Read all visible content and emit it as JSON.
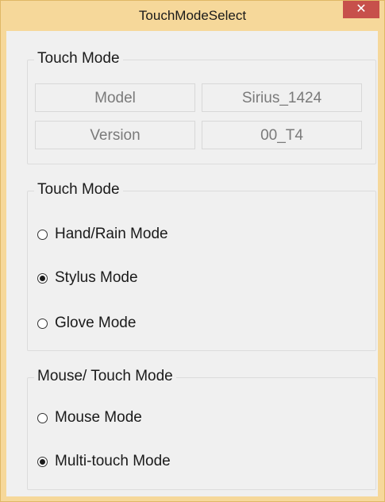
{
  "window": {
    "title": "TouchModeSelect",
    "close_label": "✕"
  },
  "info_group": {
    "title": "Touch Mode",
    "model_label": "Model",
    "model_value": "Sirius_1424",
    "version_label": "Version",
    "version_value": "00_T4"
  },
  "touch_group": {
    "title": "Touch Mode",
    "options": [
      {
        "label": "Hand/Rain Mode",
        "checked": false
      },
      {
        "label": "Stylus Mode",
        "checked": true
      },
      {
        "label": "Glove Mode",
        "checked": false
      }
    ]
  },
  "mouse_group": {
    "title": "Mouse/ Touch Mode",
    "options": [
      {
        "label": "Mouse Mode",
        "checked": false
      },
      {
        "label": "Multi-touch Mode",
        "checked": true
      }
    ]
  }
}
